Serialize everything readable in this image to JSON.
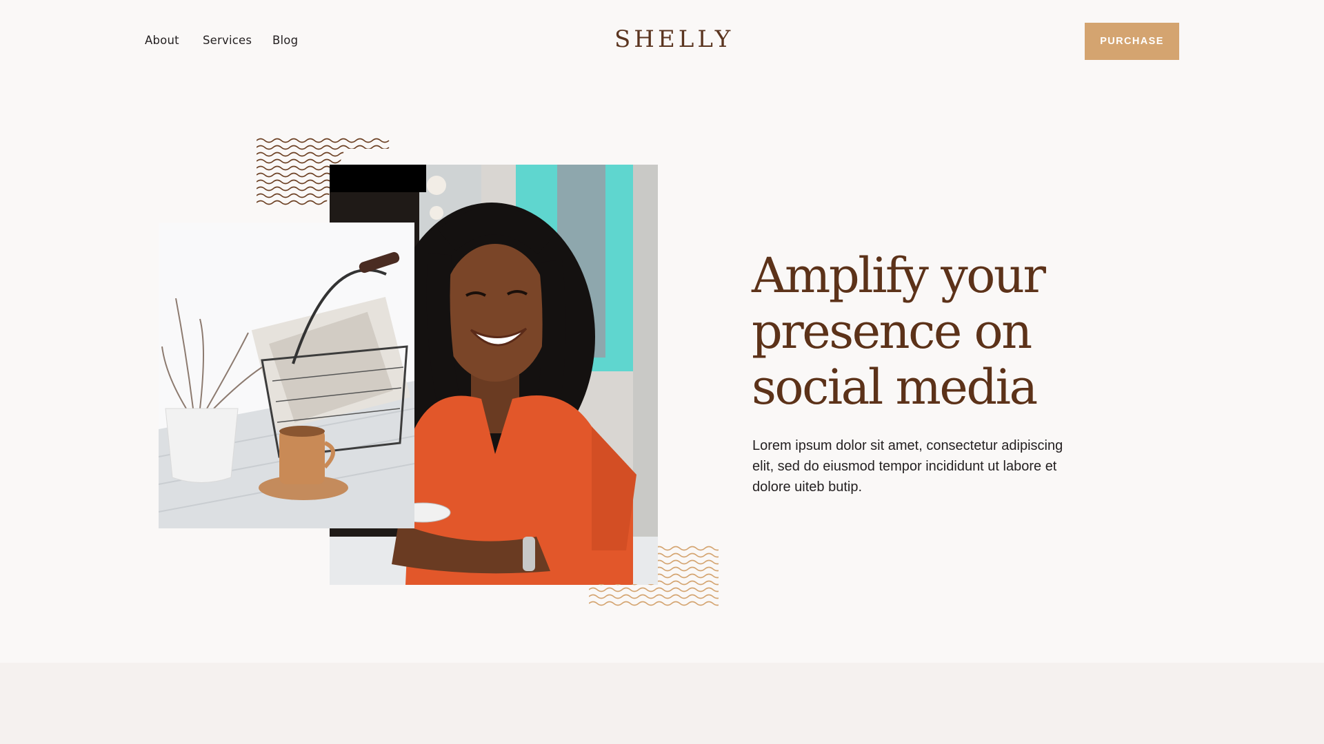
{
  "nav": {
    "links": [
      "About",
      "Services",
      "Blog"
    ],
    "brand": "SHELLY",
    "cta_label": "PURCHASE"
  },
  "hero": {
    "title_lines": [
      "Amplify your",
      "presence on",
      "social media"
    ],
    "description": "Lorem ipsum dolor sit amet, consectetur adipiscing elit, sed do eiusmod tempor incididunt ut labore et dolore uiteb butip."
  },
  "colors": {
    "background": "#faf8f7",
    "brand_brown": "#5c3219",
    "accent_tan": "#d4a470",
    "text_dark": "#231f20",
    "band": "#f5f1ef"
  }
}
